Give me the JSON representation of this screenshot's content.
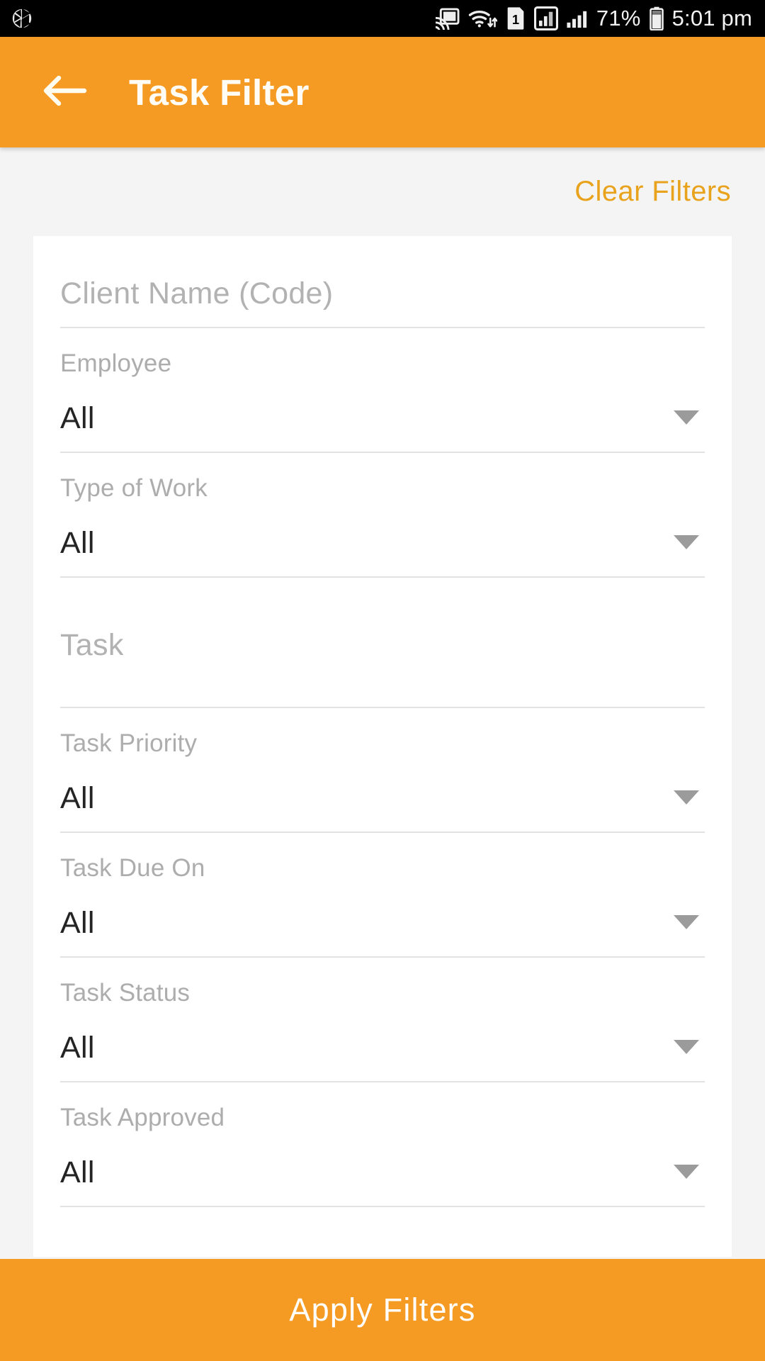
{
  "status_bar": {
    "time": "5:01 pm",
    "battery_percent": "71%",
    "icons": [
      "camera-aperture-icon",
      "cast-icon",
      "wifi-icon",
      "sim-1-icon",
      "signal-boxed-icon",
      "signal-bars-icon",
      "battery-icon"
    ]
  },
  "app_bar": {
    "title": "Task Filter",
    "back_icon": "back-arrow-icon",
    "background_color": "#F59B23"
  },
  "actions": {
    "clear_filters_label": "Clear Filters",
    "clear_filters_color": "#E9A21C",
    "apply_filters_label": "Apply Filters",
    "apply_filters_color": "#F59B23"
  },
  "form": {
    "fields": [
      {
        "id": "client-name",
        "label": "",
        "placeholder": "Client Name (Code)",
        "value": "",
        "type": "text"
      },
      {
        "id": "employee",
        "label": "Employee",
        "placeholder": "",
        "value": "All",
        "type": "select"
      },
      {
        "id": "type-of-work",
        "label": "Type of Work",
        "placeholder": "",
        "value": "All",
        "type": "select"
      },
      {
        "id": "task",
        "label": "",
        "placeholder": "Task",
        "value": "",
        "type": "text"
      },
      {
        "id": "task-priority",
        "label": "Task Priority",
        "placeholder": "",
        "value": "All",
        "type": "select"
      },
      {
        "id": "task-due-on",
        "label": "Task Due On",
        "placeholder": "",
        "value": "All",
        "type": "select"
      },
      {
        "id": "task-status",
        "label": "Task Status",
        "placeholder": "",
        "value": "All",
        "type": "select"
      },
      {
        "id": "task-approved",
        "label": "Task Approved",
        "placeholder": "",
        "value": "All",
        "type": "select"
      }
    ]
  }
}
